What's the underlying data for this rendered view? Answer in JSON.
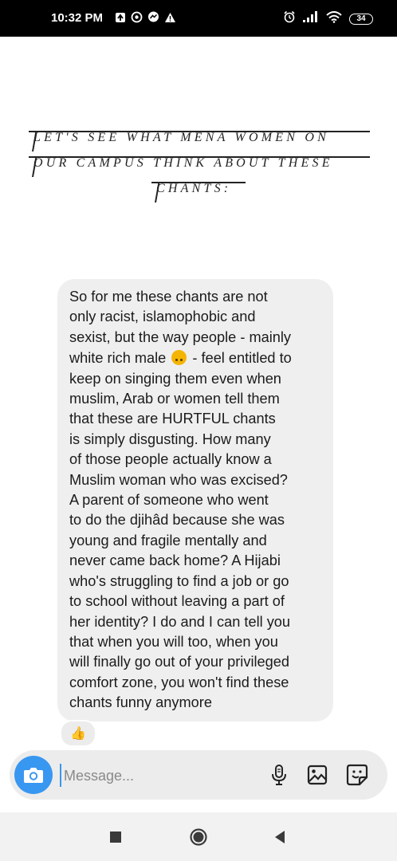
{
  "status_bar": {
    "time": "10:32 PM",
    "battery": "34",
    "left_icons": [
      "notification-icon",
      "whatsapp-icon",
      "messenger-icon",
      "warning-icon"
    ],
    "right_icons": [
      "alarm-icon",
      "signal-icon",
      "wifi-icon",
      "battery-icon"
    ]
  },
  "story": {
    "headline_lines": [
      "LET'S SEE WHAT MENA WOMEN ON",
      "OUR CAMPUS THINK ABOUT THESE",
      "CHANTS:"
    ]
  },
  "message": {
    "text_before_emoji": "So for me these chants are not\nonly racist, islamophobic and\nsexist, but the way people - mainly\nwhite rich male ",
    "emoji": "upside-down-face-icon",
    "text_after_emoji": " - feel entitled to\nkeep on singing them even when\nmuslim, Arab or women tell them\nthat these are HURTFUL chants\nis simply disgusting. How many\nof those people actually know a\nMuslim woman who was excised?\nA parent of someone who went\nto do the djihâd because she was\nyoung and fragile mentally and\nnever came back home? A Hijabi\nwho's struggling to find a job or go\nto school without leaving a part of\nher identity? I do and I can tell you\nthat when you will too, when you\nwill finally go out of your privileged\ncomfort zone, you won't find these\nchants funny anymore",
    "reaction": "👍"
  },
  "composer": {
    "placeholder": "Message...",
    "accent_color": "#3897f0",
    "icons": [
      "camera-icon",
      "microphone-icon",
      "gallery-icon",
      "sticker-icon"
    ]
  },
  "nav": {
    "icons": [
      "recent-apps-icon",
      "home-icon",
      "back-icon"
    ]
  }
}
